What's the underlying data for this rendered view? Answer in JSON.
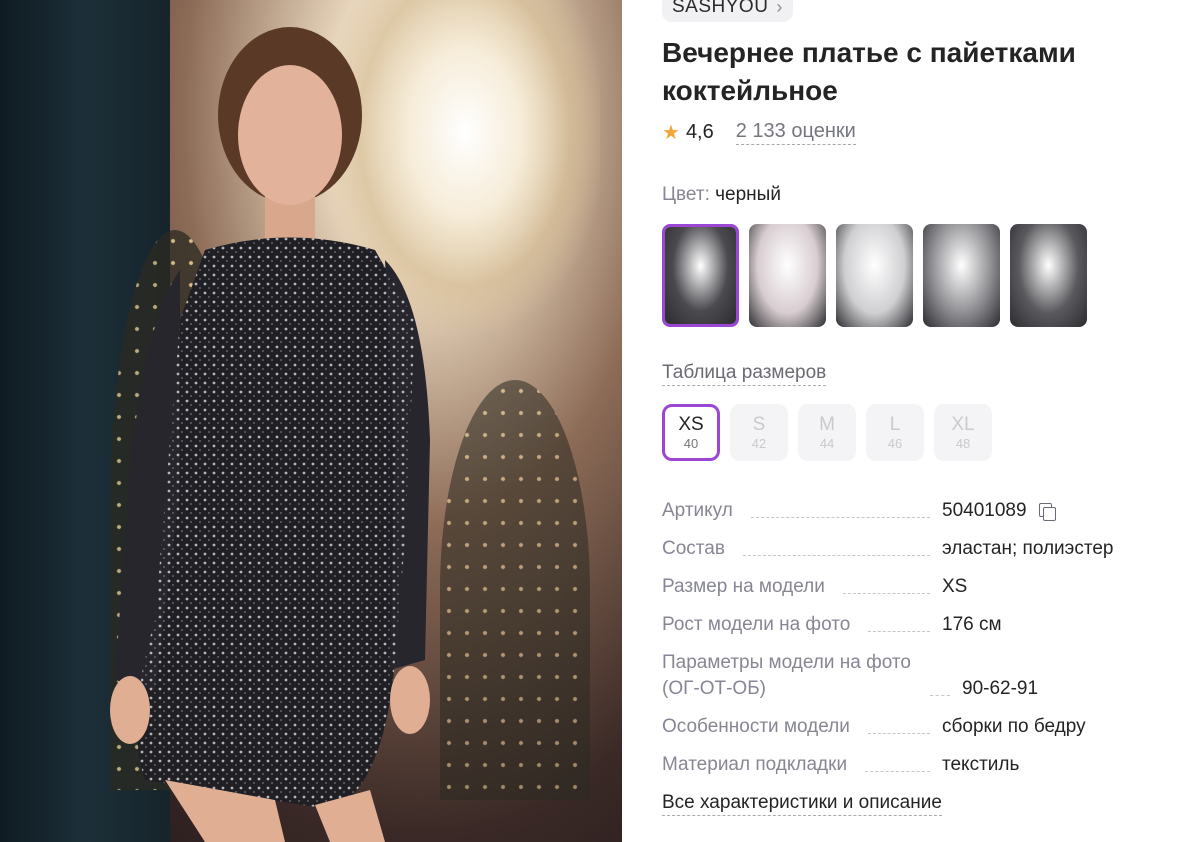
{
  "brand": {
    "name": "SASHYOU",
    "chevron_icon": "chevron-right-icon"
  },
  "product": {
    "title": "Вечернее платье с пайетками коктейльное",
    "rating": "4,6",
    "reviews": "2 133 оценки"
  },
  "color": {
    "label": "Цвет:",
    "value": "черный",
    "swatches": [
      {
        "name": "black-sequin",
        "tone": "#4a4a4f"
      },
      {
        "name": "white-dress",
        "tone": "#d8cdd0"
      },
      {
        "name": "white-wrap",
        "tone": "#cfcfd2"
      },
      {
        "name": "silver-wrap",
        "tone": "#8f8f93"
      },
      {
        "name": "black-wrap",
        "tone": "#5a5a5e"
      }
    ]
  },
  "sizes": {
    "chart_link": "Таблица размеров",
    "options": [
      {
        "label": "XS",
        "num": "40"
      },
      {
        "label": "S",
        "num": "42"
      },
      {
        "label": "M",
        "num": "44"
      },
      {
        "label": "L",
        "num": "46"
      },
      {
        "label": "XL",
        "num": "48"
      }
    ]
  },
  "specs": [
    {
      "key": "Артикул",
      "value": "50401089"
    },
    {
      "key": "Состав",
      "value": "эластан; полиэстер"
    },
    {
      "key": "Размер на модели",
      "value": "XS"
    },
    {
      "key": "Рост модели на фото",
      "value": "176 см"
    },
    {
      "key": "Параметры модели на фото (ОГ-ОТ-ОБ)",
      "value": "90-62-91"
    },
    {
      "key": "Особенности модели",
      "value": "сборки по бедру"
    },
    {
      "key": "Материал подкладки",
      "value": "текстиль"
    }
  ],
  "all_specs_link": "Все характеристики и описание",
  "colors": {
    "accent": "#9b47d3",
    "star": "#f2a738"
  }
}
